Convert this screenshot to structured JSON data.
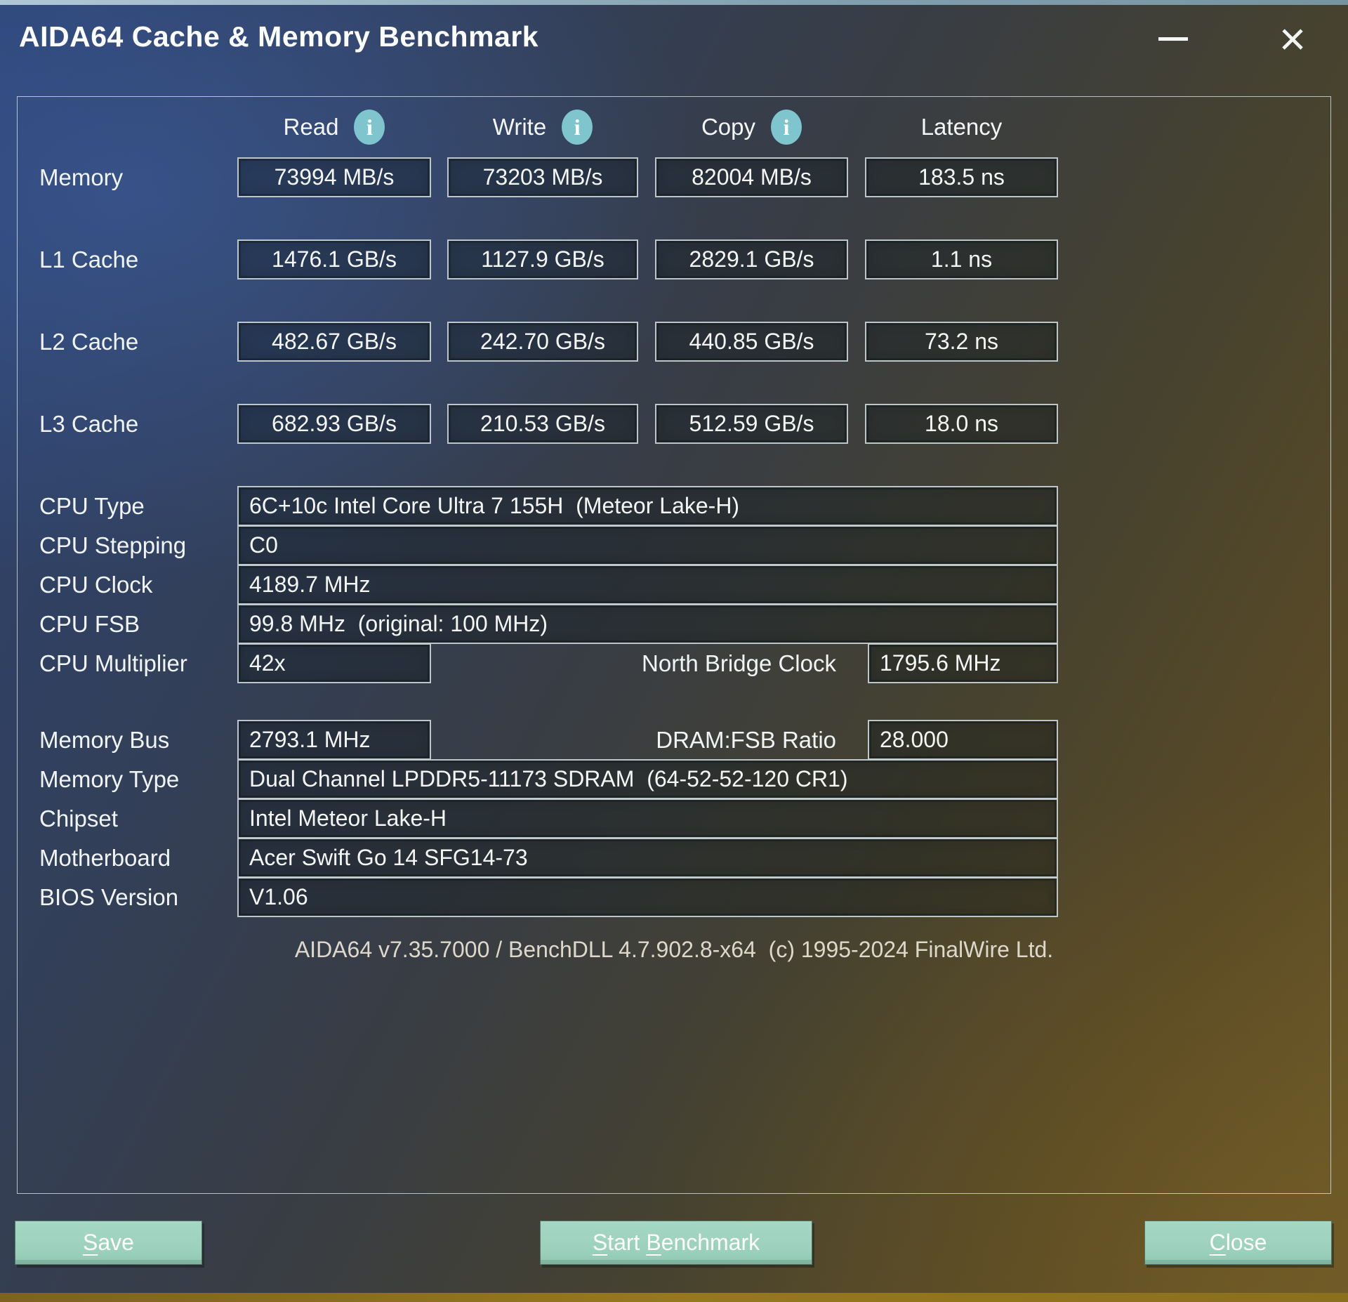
{
  "window": {
    "title": "AIDA64 Cache & Memory Benchmark"
  },
  "header": {
    "columns": [
      "Read",
      "Write",
      "Copy",
      "Latency"
    ],
    "info_icon_glyph": "i"
  },
  "benchmark": {
    "rows": [
      {
        "label": "Memory",
        "read": "73994 MB/s",
        "write": "73203 MB/s",
        "copy": "82004 MB/s",
        "latency": "183.5 ns"
      },
      {
        "label": "L1 Cache",
        "read": "1476.1 GB/s",
        "write": "1127.9 GB/s",
        "copy": "2829.1 GB/s",
        "latency": "1.1 ns"
      },
      {
        "label": "L2 Cache",
        "read": "482.67 GB/s",
        "write": "242.70 GB/s",
        "copy": "440.85 GB/s",
        "latency": "73.2 ns"
      },
      {
        "label": "L3 Cache",
        "read": "682.93 GB/s",
        "write": "210.53 GB/s",
        "copy": "512.59 GB/s",
        "latency": "18.0 ns"
      }
    ]
  },
  "cpu": {
    "type_label": "CPU Type",
    "type": "6C+10c Intel Core Ultra 7 155H  (Meteor Lake-H)",
    "stepping_label": "CPU Stepping",
    "stepping": "C0",
    "clock_label": "CPU Clock",
    "clock": "4189.7 MHz",
    "fsb_label": "CPU FSB",
    "fsb": "99.8 MHz  (original: 100 MHz)",
    "multiplier_label": "CPU Multiplier",
    "multiplier": "42x",
    "nb_clock_label": "North Bridge Clock",
    "nb_clock": "1795.6 MHz"
  },
  "memory": {
    "bus_label": "Memory Bus",
    "bus": "2793.1 MHz",
    "dram_fsb_label": "DRAM:FSB Ratio",
    "dram_fsb": "28.000",
    "type_label": "Memory Type",
    "type": "Dual Channel LPDDR5-11173 SDRAM  (64-52-52-120 CR1)",
    "chipset_label": "Chipset",
    "chipset": "Intel Meteor Lake-H",
    "motherboard_label": "Motherboard",
    "motherboard": "Acer Swift Go 14 SFG14-73",
    "bios_label": "BIOS Version",
    "bios": "V1.06"
  },
  "footer": {
    "version_text": "AIDA64 v7.35.7000 / BenchDLL 4.7.902.8-x64  (c) 1995-2024 FinalWire Ltd."
  },
  "buttons": {
    "save_accel": "S",
    "save_rest": "ave",
    "start_accel1": "S",
    "start_rest1": "tart ",
    "start_accel2": "B",
    "start_rest2": "enchmark",
    "close_accel": "C",
    "close_rest": "lose"
  },
  "colors": {
    "button_bg": "#9bd1bc",
    "info_icon_bg": "#7fc5cd",
    "bottom_strip": "#8d7220",
    "top_strip": "#bfd9e2",
    "background_top_left": "#2d4372",
    "background_bottom_right": "#6b5a2c"
  }
}
